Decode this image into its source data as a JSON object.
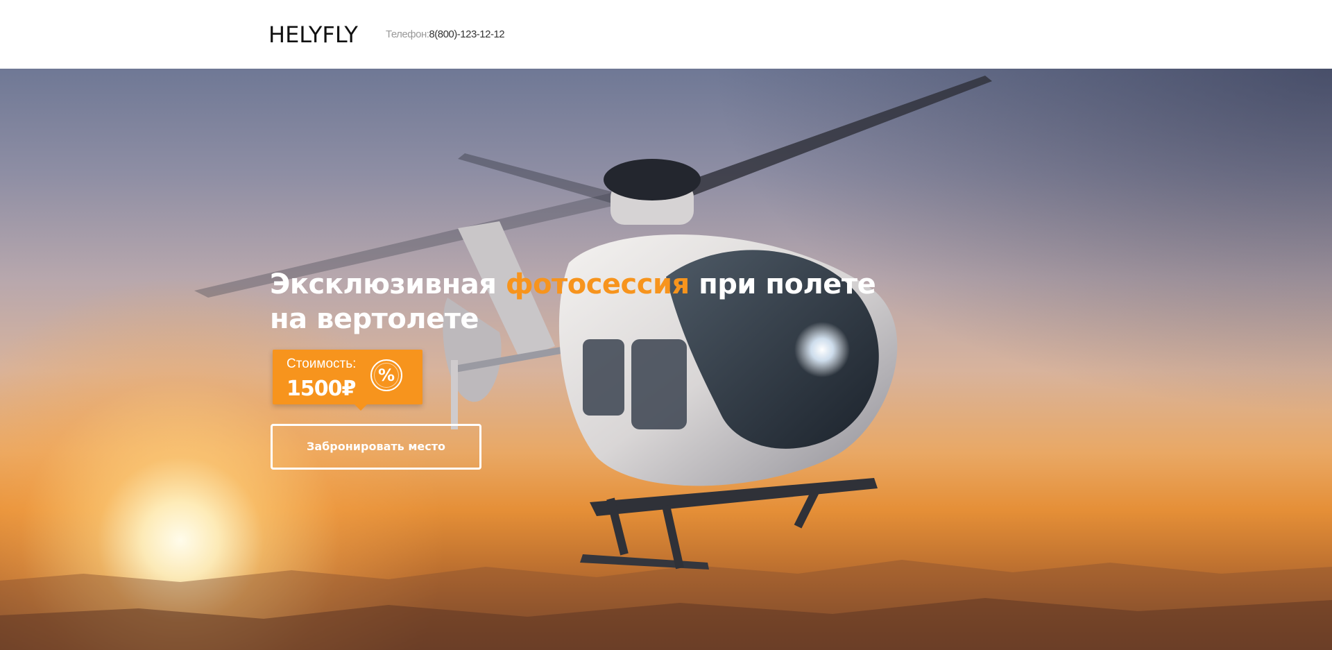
{
  "header": {
    "logo": "HELYFLY",
    "phone_label": "Телефон:",
    "phone_number": "8(800)-123-12-12"
  },
  "hero": {
    "title_part1": "Эксклюзивная ",
    "title_accent": "фотосессия",
    "title_part2": " при полете на вертолете",
    "price_label": "Стоимость:",
    "price_value": "1500₽",
    "percent_icon": "%",
    "cta_label": "Забронировать место"
  },
  "icons": {
    "percent": "percent-icon"
  },
  "colors": {
    "accent": "#f7941d",
    "header_bg": "#ffffff",
    "logo_text": "#111111",
    "phone_label": "#999999",
    "hero_text": "#ffffff"
  }
}
